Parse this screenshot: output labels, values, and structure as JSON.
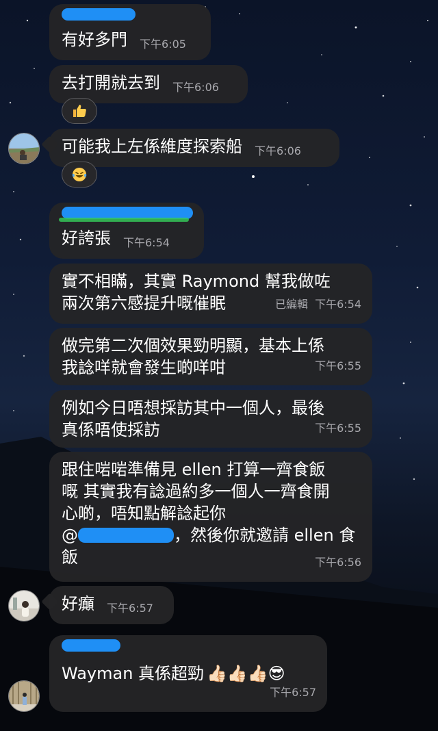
{
  "messages": [
    {
      "text": "有好多門",
      "time": "下午6:05"
    },
    {
      "text": "去打開就去到",
      "time": "下午6:06",
      "reaction": "thumbs-up"
    },
    {
      "text": "可能我上左係維度探索船",
      "time": "下午6:06",
      "reaction": "laughing-tears"
    },
    {
      "text": "好誇張",
      "time": "下午6:54"
    },
    {
      "text": "實不相瞞，其實 Raymond 幫我做咗\n兩次第六感提升嘅催眠",
      "edited": "已編輯",
      "time": "下午6:54"
    },
    {
      "text": "做完第二次個效果勁明顯，基本上係\n我諗咩就會發生啲咩咁",
      "time": "下午6:55"
    },
    {
      "text": "例如今日唔想採訪其中一個人，最後\n真係唔使採訪",
      "time": "下午6:55"
    },
    {
      "text_before": "跟住啱啱準備見 ellen 打算一齊食飯\n嘅 其實我有諗過約多一個人一齊食開\n心啲，唔知點解諗起你\n@",
      "text_after": "，然後你就邀請 ellen 食\n飯",
      "time": "下午6:56"
    },
    {
      "text": "好癲",
      "time": "下午6:57"
    },
    {
      "text": "Wayman 真係超勁",
      "emojis": "👍🏻👍🏻👍🏻😎",
      "time": "下午6:57"
    }
  ]
}
